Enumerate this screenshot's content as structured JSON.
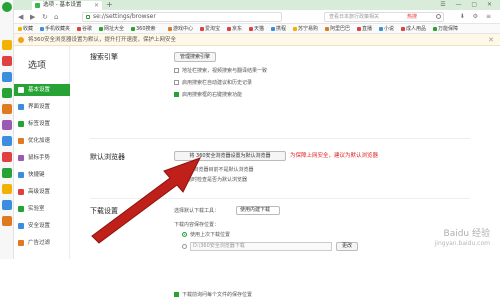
{
  "browser": {
    "tab_title": "选项 - 基本设置",
    "new_tab": "+",
    "url": "se://settings/browser",
    "search_placeholder": "查看日本旅行政策相关",
    "search_hot": "热搜",
    "window_controls": "☰ — ▢ ✕"
  },
  "bookmarks": [
    {
      "label": "收藏",
      "color": "#f2b200"
    },
    {
      "label": "手机收藏夹",
      "color": "#3b8de0"
    },
    {
      "label": "谷歌",
      "color": "#e04040"
    },
    {
      "label": "网址大全",
      "color": "#27a336"
    },
    {
      "label": "360搜索",
      "color": "#27a336"
    },
    {
      "label": "游戏中心",
      "color": "#e07a20"
    },
    {
      "label": "爱淘宝",
      "color": "#e04040"
    },
    {
      "label": "京东",
      "color": "#e04040"
    },
    {
      "label": "天猫",
      "color": "#e04040"
    },
    {
      "label": "携程",
      "color": "#3b8de0"
    },
    {
      "label": "苏宁易购",
      "color": "#f2b200"
    },
    {
      "label": "阿里巴巴",
      "color": "#e07a20"
    },
    {
      "label": "直播",
      "color": "#e04040"
    },
    {
      "label": "小说",
      "color": "#3b8de0"
    },
    {
      "label": "成人用品",
      "color": "#e04040"
    },
    {
      "label": "万能保障",
      "color": "#27a336"
    }
  ],
  "notice": {
    "text": "将360安全浏览器设置为默认，提升打开速度，保护上网安全",
    "close": "✕"
  },
  "sidebar": {
    "title": "选项",
    "items": [
      {
        "label": "基本设置",
        "color": "#ffffff"
      },
      {
        "label": "界面设置",
        "color": "#3b8de0"
      },
      {
        "label": "标签设置",
        "color": "#27a336"
      },
      {
        "label": "优化加速",
        "color": "#e07a20"
      },
      {
        "label": "鼠标手势",
        "color": "#9b59b6"
      },
      {
        "label": "快捷键",
        "color": "#3b8de0"
      },
      {
        "label": "高级设置",
        "color": "#e04040"
      },
      {
        "label": "实验室",
        "color": "#27a336"
      },
      {
        "label": "安全设置",
        "color": "#3b8de0"
      },
      {
        "label": "广告过滤",
        "color": "#e07a20"
      }
    ]
  },
  "search_engine": {
    "title": "搜索引擎",
    "manage_button": "管理搜索引擎",
    "options": [
      {
        "label": "地址栏搜索，视频搜索与翻译结果一致",
        "checked": false
      },
      {
        "label": "启用搜索栏自动建议和历史记录",
        "checked": false
      },
      {
        "label": "启用搜索框的右键搜索功能",
        "checked": true
      }
    ]
  },
  "default_browser": {
    "title": "默认浏览器",
    "set_button": "将 360安全浏览器设置为默认浏览器",
    "warning": "为保障上网安全，建议为默认浏览器",
    "sub_text": "360安全浏览器目前不是默认浏览器",
    "option": {
      "label": "启动时检查是否为默认浏览器",
      "checked": true
    }
  },
  "download": {
    "title": "下载设置",
    "select_label": "选择默认下载工具：",
    "select_value": "使用内建下载",
    "save_label": "下载内容保存位置：",
    "radio_label": "使用上次下载位置",
    "path_value": "D:\\360安全浏览器下载",
    "browse_button": "更改",
    "last_option": {
      "label": "下载前询问每个文件的保存位置",
      "checked": true
    }
  },
  "watermark": {
    "main": "Baidu 经验",
    "sub": "jingyan.baidu.com"
  }
}
